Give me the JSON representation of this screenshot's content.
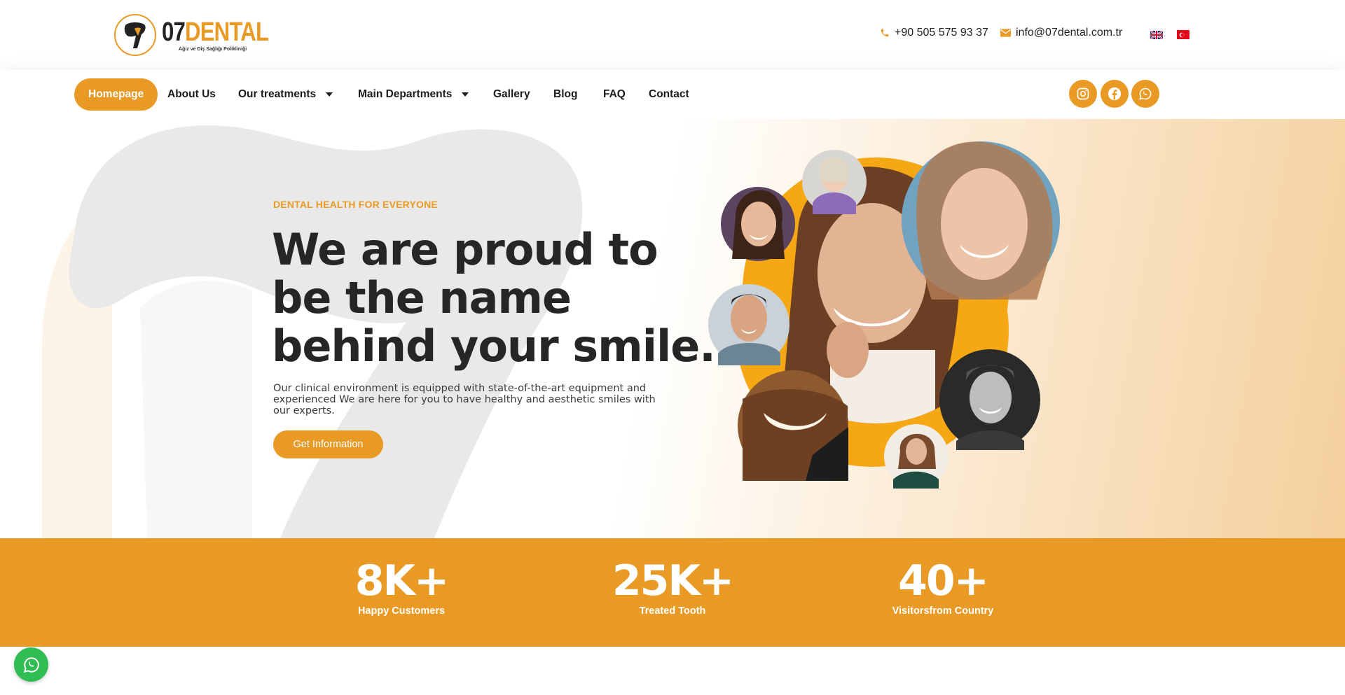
{
  "brand": {
    "number": "07",
    "name": "DENTAL",
    "tagline": "Ağız ve Diş Sağlığı Polikliniği",
    "accent_color": "#e99a25",
    "text_color": "#222222"
  },
  "topbar": {
    "phone": "+90 505 575 93 37",
    "email": "info@07dental.com.tr",
    "phone_icon": "phone-icon",
    "email_icon": "envelope-icon",
    "flags": [
      "english-flag-icon",
      "turkish-flag-icon"
    ]
  },
  "nav": {
    "items": [
      {
        "label": "Homepage",
        "active": true
      },
      {
        "label": "About Us"
      },
      {
        "label": "Our treatments",
        "dropdown": true
      },
      {
        "label": "Main Departments",
        "dropdown": true
      },
      {
        "label": "Gallery"
      },
      {
        "label": "Blog"
      },
      {
        "label": "FAQ"
      },
      {
        "label": "Contact"
      }
    ],
    "social_icons": [
      "instagram-icon",
      "facebook-icon",
      "whatsapp-icon"
    ]
  },
  "hero": {
    "eyebrow": "DENTAL HEALTH FOR EVERYONE",
    "headline_lines": [
      "We are proud to",
      "be the name",
      "behind your smile."
    ],
    "description": "Our clinical environment is equipped with state-of-the-art equipment and experienced We are here for you to have healthy and aesthetic smiles with our experts.",
    "cta_label": "Get Information"
  },
  "stats": [
    {
      "value": "8K+",
      "label": "Happy Customers"
    },
    {
      "value": "25K+",
      "label": "Treated Tooth"
    },
    {
      "value": "40+",
      "label": "Visitorsfrom Country"
    }
  ],
  "floating": {
    "whatsapp_icon": "whatsapp-icon"
  }
}
